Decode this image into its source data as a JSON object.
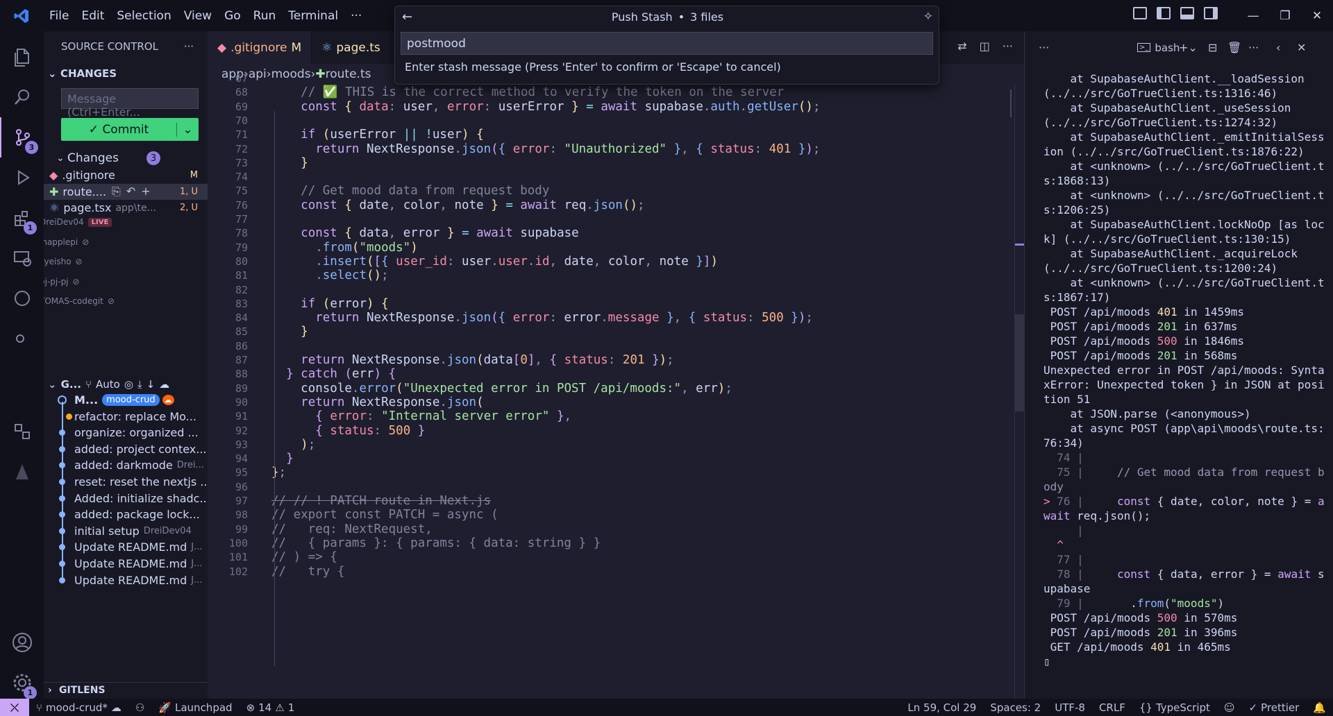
{
  "menu": {
    "items": [
      "File",
      "Edit",
      "Selection",
      "View",
      "Go",
      "Run",
      "Terminal",
      "···"
    ]
  },
  "quickpick": {
    "title": "Push Stash",
    "file_count": "3 files",
    "input_value": "postmood",
    "hint": "Enter stash message (Press 'Enter' to confirm or 'Escape' to cancel)"
  },
  "activity_badges": {
    "source_control": "3",
    "extensions": "1",
    "accounts": "1"
  },
  "sidebar": {
    "header": "SOURCE CONTROL",
    "changes_section": "CHANGES",
    "message_placeholder": "Message (Ctrl+Enter...",
    "commit_label": "Commit",
    "changes_group": "Changes",
    "changes_count": "3",
    "files": [
      {
        "name": ".gitignore",
        "path": "",
        "status": "M"
      },
      {
        "name": "route....",
        "path": "",
        "status": "1, U"
      },
      {
        "name": "page.tsx",
        "path": "app\\te...",
        "status": "2, U"
      }
    ],
    "live_users": [
      {
        "name": "DreiDev04",
        "badge": "LIVE"
      },
      {
        "name": "jhapplepi"
      },
      {
        "name": "kyeisho"
      },
      {
        "name": "pj-pj-pj"
      },
      {
        "name": "TOMAS-codegit"
      }
    ],
    "graph_section": "G...",
    "graph_mode": "Auto",
    "graph": [
      {
        "msg": "M...",
        "author": "",
        "branch": "mood-crud"
      },
      {
        "msg": "refactor: replace Mo...",
        "author": ""
      },
      {
        "msg": "organize: organized ...",
        "author": ""
      },
      {
        "msg": "added: project contex...",
        "author": ""
      },
      {
        "msg": "added: darkmode",
        "author": "Drei..."
      },
      {
        "msg": "reset: reset the nextjs ...",
        "author": ""
      },
      {
        "msg": "Added: initialize shadc...",
        "author": ""
      },
      {
        "msg": "added: package lock...",
        "author": ""
      },
      {
        "msg": "initial setup",
        "author": "DreiDev04"
      },
      {
        "msg": "Update README.md",
        "author": "J..."
      },
      {
        "msg": "Update README.md",
        "author": "J..."
      },
      {
        "msg": "Update README.md",
        "author": "J..."
      }
    ],
    "gitlens": "GITLENS"
  },
  "tabs": [
    {
      "label": ".gitignore",
      "status": "M"
    },
    {
      "label": "page.ts",
      "status": ""
    }
  ],
  "breadcrumb": [
    "app",
    "api",
    "moods",
    "route.ts"
  ],
  "code_lines": [
    {
      "n": "67",
      "html": ""
    },
    {
      "n": "68",
      "html": "    <span class='cm'>// </span><span class='str'>✅</span><span class='cm'> THIS is the correct method to verify the token on the server</span>"
    },
    {
      "n": "69",
      "html": "    <span class='kw'>const</span> <span class='br1'>{</span> <span class='var'>data</span><span class='pn'>:</span> <span class='tx'>user</span><span class='pn'>,</span> <span class='var'>error</span><span class='pn'>:</span> <span class='tx'>userError</span> <span class='br1'>}</span> <span class='prop'>=</span> <span class='kw'>await</span> <span class='tx'>supabase</span><span class='pn'>.</span><span class='fn'>auth</span><span class='pn'>.</span><span class='fn'>getUser</span><span class='br1'>()</span><span class='pn'>;</span>"
    },
    {
      "n": "70",
      "html": ""
    },
    {
      "n": "71",
      "html": "    <span class='kw'>if</span> <span class='br1'>(</span><span class='tx'>userError</span> <span class='prop'>||</span> <span class='prop'>!</span><span class='tx'>user</span><span class='br1'>)</span> <span class='br1'>{</span>"
    },
    {
      "n": "72",
      "html": "      <span class='kw'>return</span> <span class='tx'>NextResponse</span><span class='pn'>.</span><span class='fn'>json</span><span class='br2'>(</span><span class='br3'>{</span> <span class='var'>error</span><span class='pn'>:</span> <span class='str'>\"Unauthorized\"</span> <span class='br3'>}</span><span class='pn'>,</span> <span class='br3'>{</span> <span class='var'>status</span><span class='pn'>:</span> <span class='num'>401</span> <span class='br3'>}</span><span class='br2'>)</span><span class='pn'>;</span>"
    },
    {
      "n": "73",
      "html": "    <span class='br1'>}</span>"
    },
    {
      "n": "74",
      "html": ""
    },
    {
      "n": "75",
      "html": "    <span class='cm'>// Get mood data from request body</span>"
    },
    {
      "n": "76",
      "html": "    <span class='kw'>const</span> <span class='br1'>{</span> <span class='tx'>date</span><span class='pn'>,</span> <span class='tx'>color</span><span class='pn'>,</span> <span class='tx'>note</span> <span class='br1'>}</span> <span class='prop'>=</span> <span class='kw'>await</span> <span class='tx'>req</span><span class='pn'>.</span><span class='fn'>json</span><span class='br1'>()</span><span class='pn'>;</span>"
    },
    {
      "n": "77",
      "html": ""
    },
    {
      "n": "78",
      "html": "    <span class='kw'>const</span> <span class='br1'>{</span> <span class='tx'>data</span><span class='pn'>,</span> <span class='tx'>error</span> <span class='br1'>}</span> <span class='prop'>=</span> <span class='kw'>await</span> <span class='tx'>supabase</span>"
    },
    {
      "n": "79",
      "html": "      <span class='pn'>.</span><span class='fn'>from</span><span class='br1'>(</span><span class='str'>\"moods\"</span><span class='br1'>)</span>"
    },
    {
      "n": "80",
      "html": "      <span class='pn'>.</span><span class='fn'>insert</span><span class='br1'>(</span><span class='br2'>[</span><span class='br3'>{</span> <span class='var'>user_id</span><span class='pn'>:</span> <span class='tx'>user</span><span class='pn'>.</span><span class='var'>user</span><span class='pn'>.</span><span class='var'>id</span><span class='pn'>,</span> <span class='tx'>date</span><span class='pn'>,</span> <span class='tx'>color</span><span class='pn'>,</span> <span class='tx'>note</span> <span class='br3'>}</span><span class='br2'>]</span><span class='br1'>)</span>"
    },
    {
      "n": "81",
      "html": "      <span class='pn'>.</span><span class='fn'>select</span><span class='br1'>()</span><span class='pn'>;</span>"
    },
    {
      "n": "82",
      "html": ""
    },
    {
      "n": "83",
      "html": "    <span class='kw'>if</span> <span class='br1'>(</span><span class='tx'>error</span><span class='br1'>)</span> <span class='br1'>{</span>"
    },
    {
      "n": "84",
      "html": "      <span class='kw'>return</span> <span class='tx'>NextResponse</span><span class='pn'>.</span><span class='fn'>json</span><span class='br2'>(</span><span class='br3'>{</span> <span class='var'>error</span><span class='pn'>:</span> <span class='tx'>error</span><span class='pn'>.</span><span class='var'>message</span> <span class='br3'>}</span><span class='pn'>,</span> <span class='br3'>{</span> <span class='var'>status</span><span class='pn'>:</span> <span class='num'>500</span> <span class='br3'>}</span><span class='br2'>)</span><span class='pn'>;</span>"
    },
    {
      "n": "85",
      "html": "    <span class='br1'>}</span>"
    },
    {
      "n": "86",
      "html": ""
    },
    {
      "n": "87",
      "html": "    <span class='kw'>return</span> <span class='tx'>NextResponse</span><span class='pn'>.</span><span class='fn'>json</span><span class='br1'>(</span><span class='tx'>data</span><span class='br2'>[</span><span class='num'>0</span><span class='br2'>]</span><span class='pn'>,</span> <span class='br2'>{</span> <span class='var'>status</span><span class='pn'>:</span> <span class='num'>201</span> <span class='br2'>}</span><span class='br1'>)</span><span class='pn'>;</span>"
    },
    {
      "n": "88",
      "html": "  <span class='br2'>}</span> <span class='kw'>catch</span> <span class='br2'>(</span><span class='tx'>err</span><span class='br2'>)</span> <span class='br2'>{</span>"
    },
    {
      "n": "89",
      "html": "    <span class='tx'>console</span><span class='pn'>.</span><span class='fn'>error</span><span class='br1'>(</span><span class='str'>\"Unexpected error in POST /api/moods:\"</span><span class='pn'>,</span> <span class='tx'>err</span><span class='br1'>)</span><span class='pn'>;</span>"
    },
    {
      "n": "90",
      "html": "    <span class='kw'>return</span> <span class='tx'>NextResponse</span><span class='pn'>.</span><span class='fn'>json</span><span class='br1'>(</span>"
    },
    {
      "n": "91",
      "html": "      <span class='br2'>{</span> <span class='var'>error</span><span class='pn'>:</span> <span class='str'>\"Internal server error\"</span> <span class='br2'>}</span><span class='pn'>,</span>"
    },
    {
      "n": "92",
      "html": "      <span class='br2'>{</span> <span class='var'>status</span><span class='pn'>:</span> <span class='num'>500</span> <span class='br2'>}</span>"
    },
    {
      "n": "93",
      "html": "    <span class='br1'>)</span><span class='pn'>;</span>"
    },
    {
      "n": "94",
      "html": "  <span class='br2'>}</span>"
    },
    {
      "n": "95",
      "html": "<span class='br1'>}</span><span class='pn'>;</span>"
    },
    {
      "n": "96",
      "html": ""
    },
    {
      "n": "97",
      "html": "<span class='cm' style='text-decoration:line-through'>// // ! PATCH route in Next.js</span>"
    },
    {
      "n": "98",
      "html": "<span class='cm'>// export const PATCH = async (</span>"
    },
    {
      "n": "99",
      "html": "<span class='cm'>//   req: NextRequest,</span>"
    },
    {
      "n": "100",
      "html": "<span class='cm'>//   { params }: { params: { data: string } }</span>"
    },
    {
      "n": "101",
      "html": "<span class='cm'>// ) => {</span>"
    },
    {
      "n": "102",
      "html": "<span class='cm'>//   try {</span>"
    }
  ],
  "terminal": {
    "tab_label": "bash",
    "lines_html": [
      "    at SupabaseAuthClient.__loadSession (../../src/GoTrueClient.ts:1316:46)",
      "    at SupabaseAuthClient._useSession (../../src/GoTrueClient.ts:1274:32)",
      "    at SupabaseAuthClient._emitInitialSession (../../src/GoTrueClient.ts:1876:22)",
      "    at &lt;unknown&gt; (../../src/GoTrueClient.ts:1868:13)",
      "    at &lt;unknown&gt; (../../src/GoTrueClient.ts:1206:25)",
      "    at SupabaseAuthClient.lockNoOp [as lock] (../../src/GoTrueClient.ts:130:15)",
      "    at SupabaseAuthClient._acquireLock (../../src/GoTrueClient.ts:1200:24)",
      "    at &lt;unknown&gt; (../../src/GoTrueClient.ts:1867:17)",
      " POST /api/moods <span style='color:#f9e2af'>401</span> in 1459ms",
      " POST /api/moods <span style='color:#a6e3a1'>201</span> in 637ms",
      " POST /api/moods <span style='color:#f38ba8'>500</span> in 1846ms",
      " POST /api/moods <span style='color:#a6e3a1'>201</span> in 568ms",
      "Unexpected error in POST /api/moods: SyntaxError: Unexpected token } in JSON at position 51",
      "    at JSON.parse (&lt;anonymous&gt;)",
      "    at async POST (app\\api\\moods\\route.ts:76:34)",
      "<span style='color:#6c7086'>  74 |</span>",
      "<span style='color:#6c7086'>  75 |</span>     <span style='color:#9399b2'>// Get mood data from request body</span>",
      "<span style='color:#f38ba8'>&gt;</span> <span style='color:#6c7086'>76 |</span>     <span style='color:#cba6f7'>const</span> { date, color, note } = <span style='color:#cba6f7'>await</span> req.json();",
      "<span style='color:#6c7086'>     |</span>",
      "<span style='color:#f38ba8'>  ^</span>",
      "<span style='color:#6c7086'>  77 |</span>",
      "<span style='color:#6c7086'>  78 |</span>     <span style='color:#cba6f7'>const</span> { data, error } = <span style='color:#cba6f7'>await</span> supabase",
      "<span style='color:#6c7086'>  79 |</span>       .<span style='color:#89b4fa'>from</span>(<span style='color:#a6e3a1'>\"moods\"</span>)",
      " POST /api/moods <span style='color:#f38ba8'>500</span> in 570ms",
      " POST /api/moods <span style='color:#a6e3a1'>201</span> in 396ms",
      " GET /api/moods <span style='color:#f9e2af'>401</span> in 465ms",
      "▯"
    ]
  },
  "status": {
    "branch": "mood-crud*",
    "launchpad": "Launchpad",
    "errors": "14",
    "warnings": "1",
    "position": "Ln 59, Col 29",
    "spaces": "Spaces: 2",
    "encoding": "UTF-8",
    "eol": "CRLF",
    "language": "TypeScript",
    "formatter": "Prettier"
  }
}
